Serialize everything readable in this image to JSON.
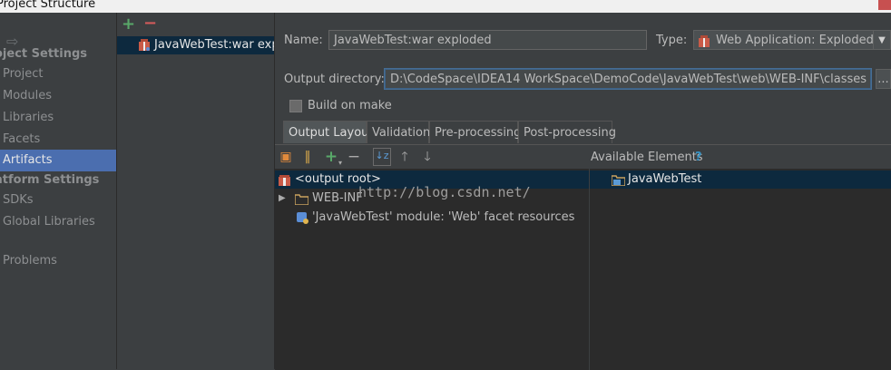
{
  "window": {
    "title": "Project Structure"
  },
  "nav": {
    "sections": [
      {
        "title": "oject Settings",
        "items": [
          "Project",
          "Modules",
          "Libraries",
          "Facets",
          "Artifacts"
        ]
      },
      {
        "title": "atform Settings",
        "items": [
          "SDKs",
          "Global Libraries"
        ]
      }
    ],
    "problems": "Problems",
    "selected": "Artifacts"
  },
  "artifacts": {
    "add": "+",
    "remove": "−",
    "items": [
      "JavaWebTest:war exploded"
    ]
  },
  "form": {
    "name_label": "Name:",
    "name_value": "JavaWebTest:war exploded",
    "type_label": "Type:",
    "type_value": "Web Application: Exploded",
    "output_label": "Output directory:",
    "output_value": "D:\\CodeSpace\\IDEA14 WorkSpace\\DemoCode\\JavaWebTest\\web\\WEB-INF\\classes",
    "browse": "...",
    "build_on_make": "Build on make"
  },
  "tabs": [
    "Output Layout",
    "Validation",
    "Pre-processing",
    "Post-processing"
  ],
  "layout": {
    "available_elements_label": "Available Elements",
    "help": "?",
    "tree": [
      "<output root>",
      "WEB-INF",
      "'JavaWebTest' module: 'Web' facet resources"
    ],
    "available": [
      "JavaWebTest"
    ],
    "watermark": "http://blog.csdn.net/"
  },
  "colors": {
    "accent": "#4b6eaf",
    "selection": "#0d293e",
    "background": "#3c3f41"
  }
}
